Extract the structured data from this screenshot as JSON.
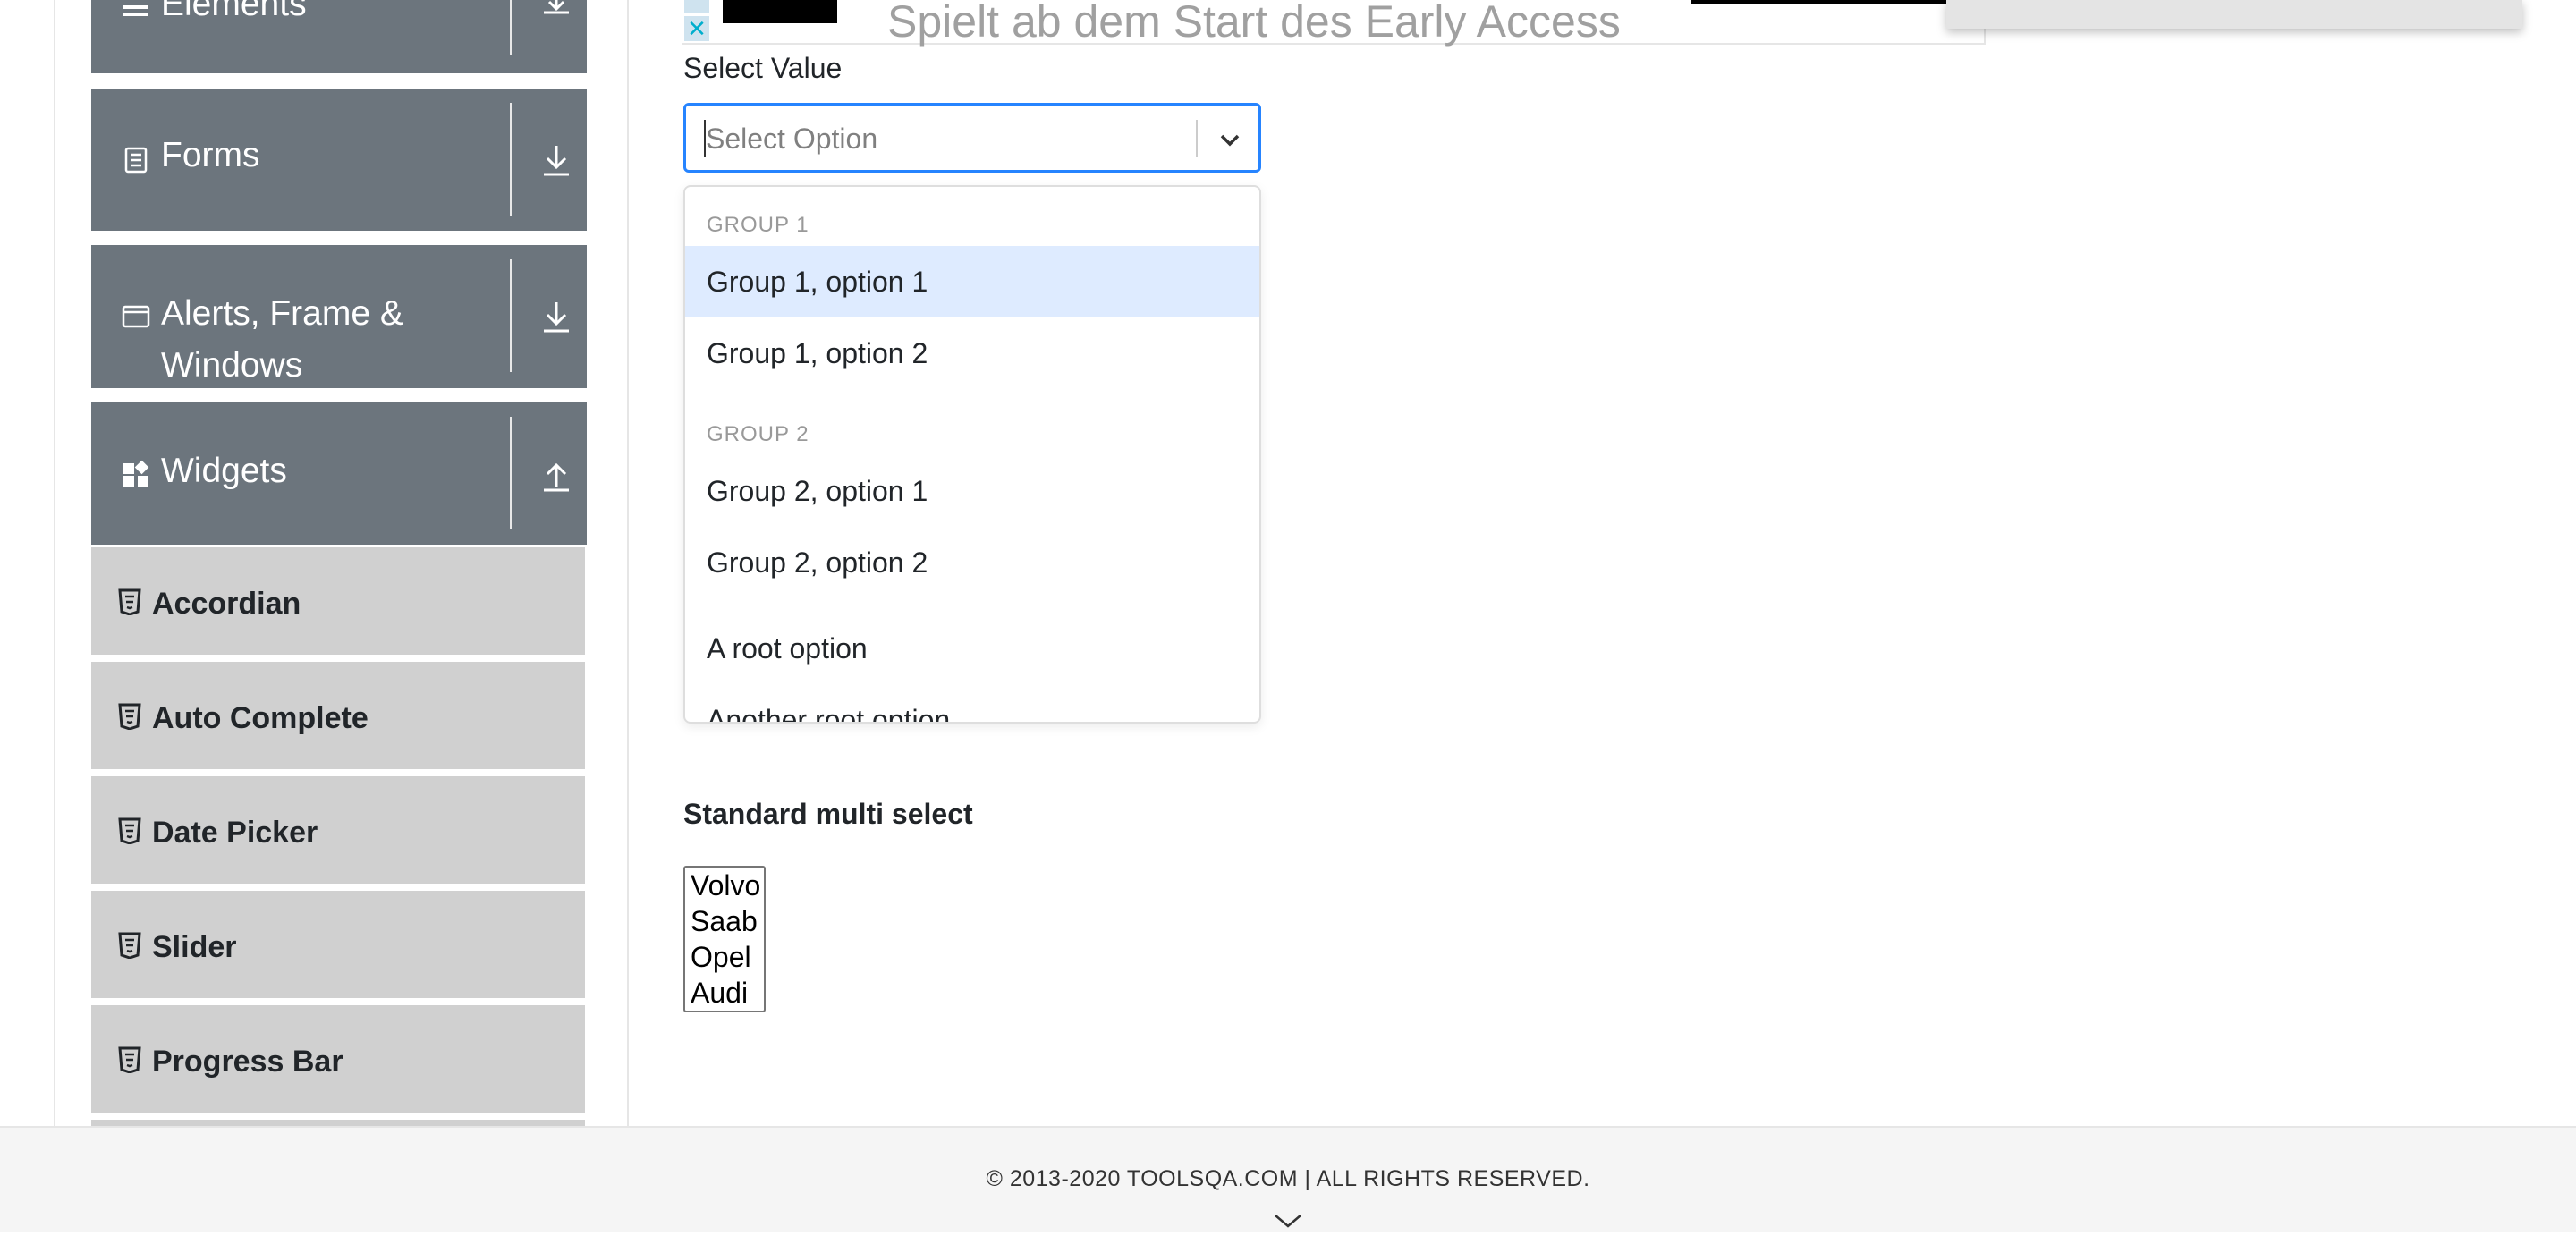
{
  "sidebar": {
    "groups": [
      {
        "label": "Elements",
        "icon": "hamburger-icon",
        "arrow": "download-icon"
      },
      {
        "label": "Forms",
        "icon": "document-icon",
        "arrow": "download-icon"
      },
      {
        "label_line1": "Alerts, Frame &",
        "label_line2": "Windows",
        "icon": "window-icon",
        "arrow": "download-icon"
      },
      {
        "label": "Widgets",
        "icon": "widgets-icon",
        "arrow": "upload-icon"
      }
    ],
    "items": [
      {
        "label": "Accordian"
      },
      {
        "label": "Auto Complete"
      },
      {
        "label": "Date Picker"
      },
      {
        "label": "Slider"
      },
      {
        "label": "Progress Bar"
      }
    ]
  },
  "ad": {
    "text": "Spielt ab dem Start des Early Access",
    "close_glyph": "✕"
  },
  "select": {
    "label": "Select Value",
    "placeholder": "Select Option",
    "groups": [
      {
        "heading": "GROUP 1",
        "options": [
          "Group 1, option 1",
          "Group 1, option 2"
        ]
      },
      {
        "heading": "GROUP 2",
        "options": [
          "Group 2, option 1",
          "Group 2, option 2"
        ]
      }
    ],
    "root_options": [
      "A root option",
      "Another root option"
    ],
    "focused_option": "Group 1, option 1"
  },
  "multi_select": {
    "title": "Standard multi select",
    "options": [
      "Volvo",
      "Saab",
      "Opel",
      "Audi"
    ]
  },
  "footer": {
    "text": "© 2013-2020 TOOLSQA.COM | ALL RIGHTS RESERVED."
  },
  "colors": {
    "sidebar_group": "#6c757d",
    "sidebar_item": "#d0d0d0",
    "focus_border": "#2684ff",
    "option_focus": "#deebff"
  }
}
